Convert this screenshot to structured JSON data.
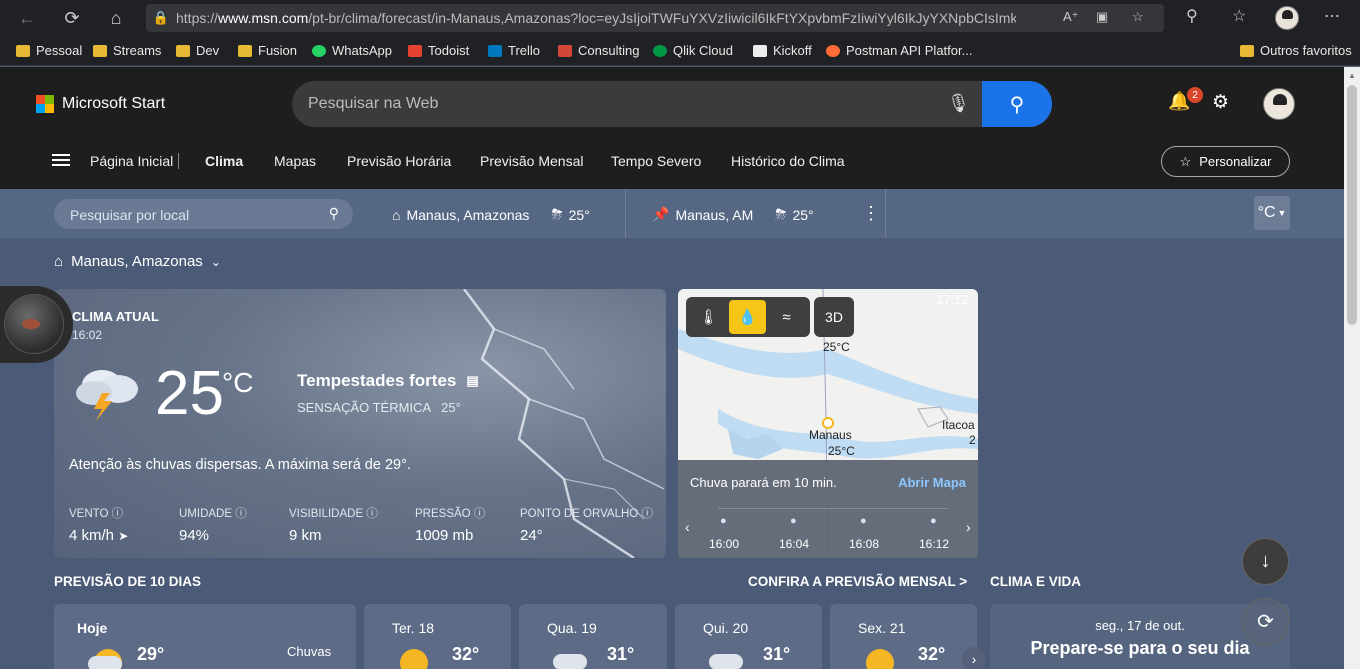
{
  "browser": {
    "url_prefix": "https://",
    "url_host": "www.msn.com",
    "url_path": "/pt-br/clima/forecast/in-Manaus,Amazonas?loc=eyJsIjoiTWFuYXVzIiwicil6IkFtYXpvbmFzIiwiYyl6IkJyYXNpbCIsImkiOi..."
  },
  "bookmarks": [
    {
      "label": "Pessoal",
      "icon": "folder-icon"
    },
    {
      "label": "Streams",
      "icon": "folder-icon"
    },
    {
      "label": "Dev",
      "icon": "folder-icon"
    },
    {
      "label": "Fusion",
      "icon": "folder-icon"
    },
    {
      "label": "WhatsApp",
      "icon": "whatsapp-icon"
    },
    {
      "label": "Todoist",
      "icon": "todoist-icon"
    },
    {
      "label": "Trello",
      "icon": "trello-icon"
    },
    {
      "label": "Consulting",
      "icon": "gmail-icon"
    },
    {
      "label": "Qlik Cloud",
      "icon": "qlik-icon"
    },
    {
      "label": "Kickoff",
      "icon": "kickoff-icon"
    },
    {
      "label": "Postman API Platfor...",
      "icon": "postman-icon"
    }
  ],
  "other_favorites": "Outros favoritos",
  "header": {
    "brand": "Microsoft Start",
    "search_placeholder": "Pesquisar na Web",
    "notifications": "2",
    "nav": [
      "Página Inicial",
      "Clima",
      "Mapas",
      "Previsão Horária",
      "Previsão Mensal",
      "Tempo Severo",
      "Histórico do Clima"
    ],
    "personalize": "Personalizar"
  },
  "locations": {
    "search_placeholder": "Pesquisar por local",
    "home_name": "Manaus, Amazonas",
    "home_temp": "25°",
    "pinned_name": "Manaus, AM",
    "pinned_temp": "25°",
    "unit": "°C"
  },
  "city": "Manaus, Amazonas",
  "current": {
    "label": "CLIMA ATUAL",
    "time": "16:02",
    "temp": "25",
    "unit": "°C",
    "condition": "Tempestades fortes",
    "feels_label": "SENSAÇÃO TÉRMICA",
    "feels_value": "25°",
    "alert": "Atenção às chuvas dispersas. A máxima será de 29°.",
    "metrics": [
      {
        "key": "VENTO",
        "value": "4 km/h"
      },
      {
        "key": "UMIDADE",
        "value": "94%"
      },
      {
        "key": "VISIBILIDADE",
        "value": "9 km"
      },
      {
        "key": "PRESSÃO",
        "value": "1009 mb"
      },
      {
        "key": "PONTO DE ORVALHO",
        "value": "24°"
      }
    ]
  },
  "map": {
    "time": "17:12",
    "btn_3d": "3D",
    "city_main": "Manaus",
    "city_main_temp": "25°C",
    "city_top_temp": "25°C",
    "city_right": "Itacoa",
    "city_right_temp": "2",
    "message": "Chuva parará em 10 min.",
    "open": "Abrir Mapa",
    "ticks": [
      "16:00",
      "16:04",
      "16:08",
      "16:12"
    ]
  },
  "forecast": {
    "title": "PREVISÃO DE 10 DIAS",
    "monthly_link": "CONFIRA A PREVISÃO MENSAL >",
    "days": [
      {
        "name": "Hoje",
        "temp": "29°",
        "note": "Chuvas"
      },
      {
        "name": "Ter. 18",
        "temp": "32°"
      },
      {
        "name": "Qua. 19",
        "temp": "31°"
      },
      {
        "name": "Qui. 20",
        "temp": "31°"
      },
      {
        "name": "Sex. 21",
        "temp": "32°"
      }
    ]
  },
  "life": {
    "title": "CLIMA E VIDA",
    "date": "seg., 17 de out.",
    "headline": "Prepare-se para o seu dia"
  }
}
